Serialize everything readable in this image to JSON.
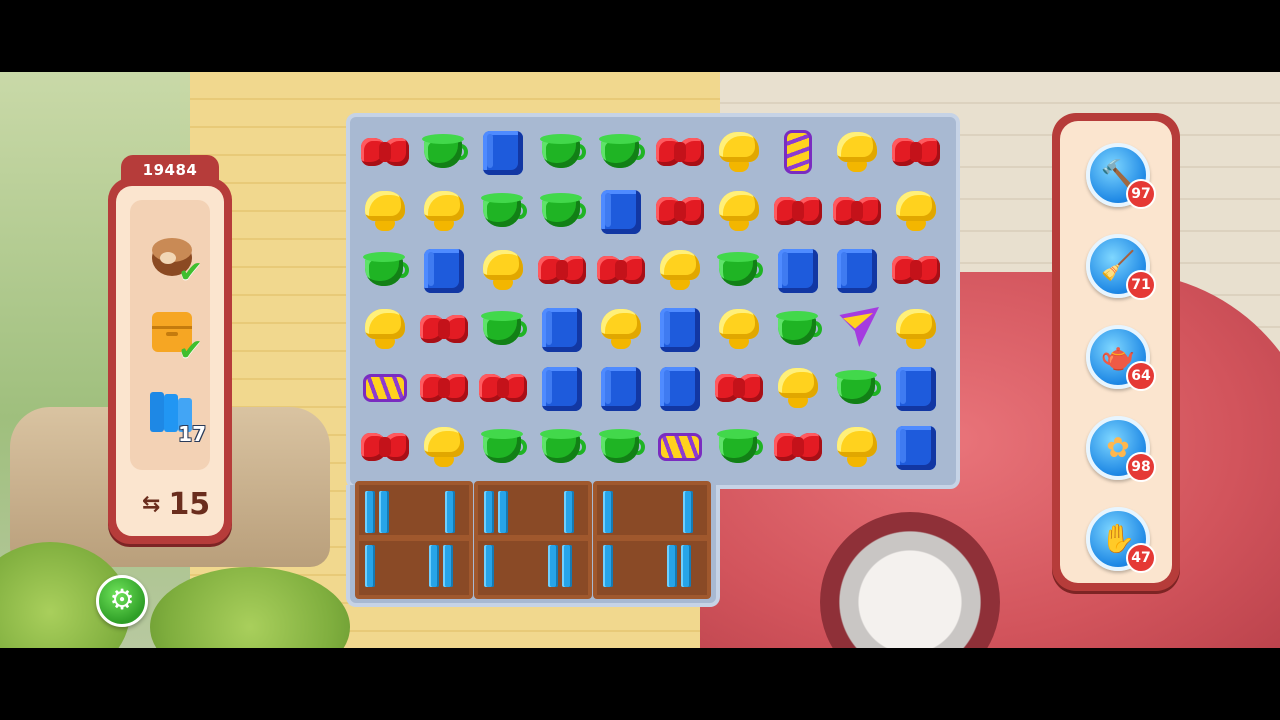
{
  "score": "19484",
  "goals": [
    {
      "name": "nut",
      "icon": "nut-icon",
      "status": "done"
    },
    {
      "name": "box",
      "icon": "box-icon",
      "status": "done"
    },
    {
      "name": "books",
      "icon": "books-icon",
      "count": "17"
    }
  ],
  "moves": {
    "icon": "swap-arrows-icon",
    "value": "15"
  },
  "settings": {
    "icon": "gear-icon"
  },
  "board": {
    "rows": [
      [
        "bow",
        "cup",
        "book",
        "cup",
        "cup",
        "bow",
        "lamp",
        "rocket-v",
        "lamp",
        "bow"
      ],
      [
        "lamp",
        "lamp",
        "cup",
        "cup",
        "book",
        "bow",
        "lamp",
        "bow",
        "bow",
        "lamp"
      ],
      [
        "cup",
        "book",
        "lamp",
        "bow",
        "bow",
        "lamp",
        "cup",
        "book",
        "book",
        "bow"
      ],
      [
        "lamp",
        "bow",
        "cup",
        "book",
        "lamp",
        "book",
        "lamp",
        "cup",
        "plane",
        "lamp"
      ],
      [
        "rocket-h",
        "bow",
        "bow",
        "book",
        "book",
        "book",
        "bow",
        "lamp",
        "cup",
        "book"
      ],
      [
        "bow",
        "lamp",
        "cup",
        "cup",
        "cup",
        "rocket-h",
        "cup",
        "bow",
        "lamp",
        "book"
      ]
    ],
    "shelves": 3
  },
  "boosters": [
    {
      "name": "hammer",
      "icon": "hammer-icon",
      "glyph": "🔨",
      "count": "97"
    },
    {
      "name": "broom",
      "icon": "broom-icon",
      "glyph": "🧹",
      "count": "71"
    },
    {
      "name": "watering-can",
      "icon": "watering-can-icon",
      "glyph": "🫖",
      "count": "64"
    },
    {
      "name": "fan",
      "icon": "fan-icon",
      "glyph": "✿",
      "count": "98"
    },
    {
      "name": "glove",
      "icon": "glove-icon",
      "glyph": "✋",
      "count": "47"
    }
  ],
  "colors": {
    "panel": "#b63c3a",
    "panel_inner": "#fbe5cf",
    "board": "#a8b9d2",
    "booster": "#1e88e5",
    "badge": "#e53935"
  }
}
